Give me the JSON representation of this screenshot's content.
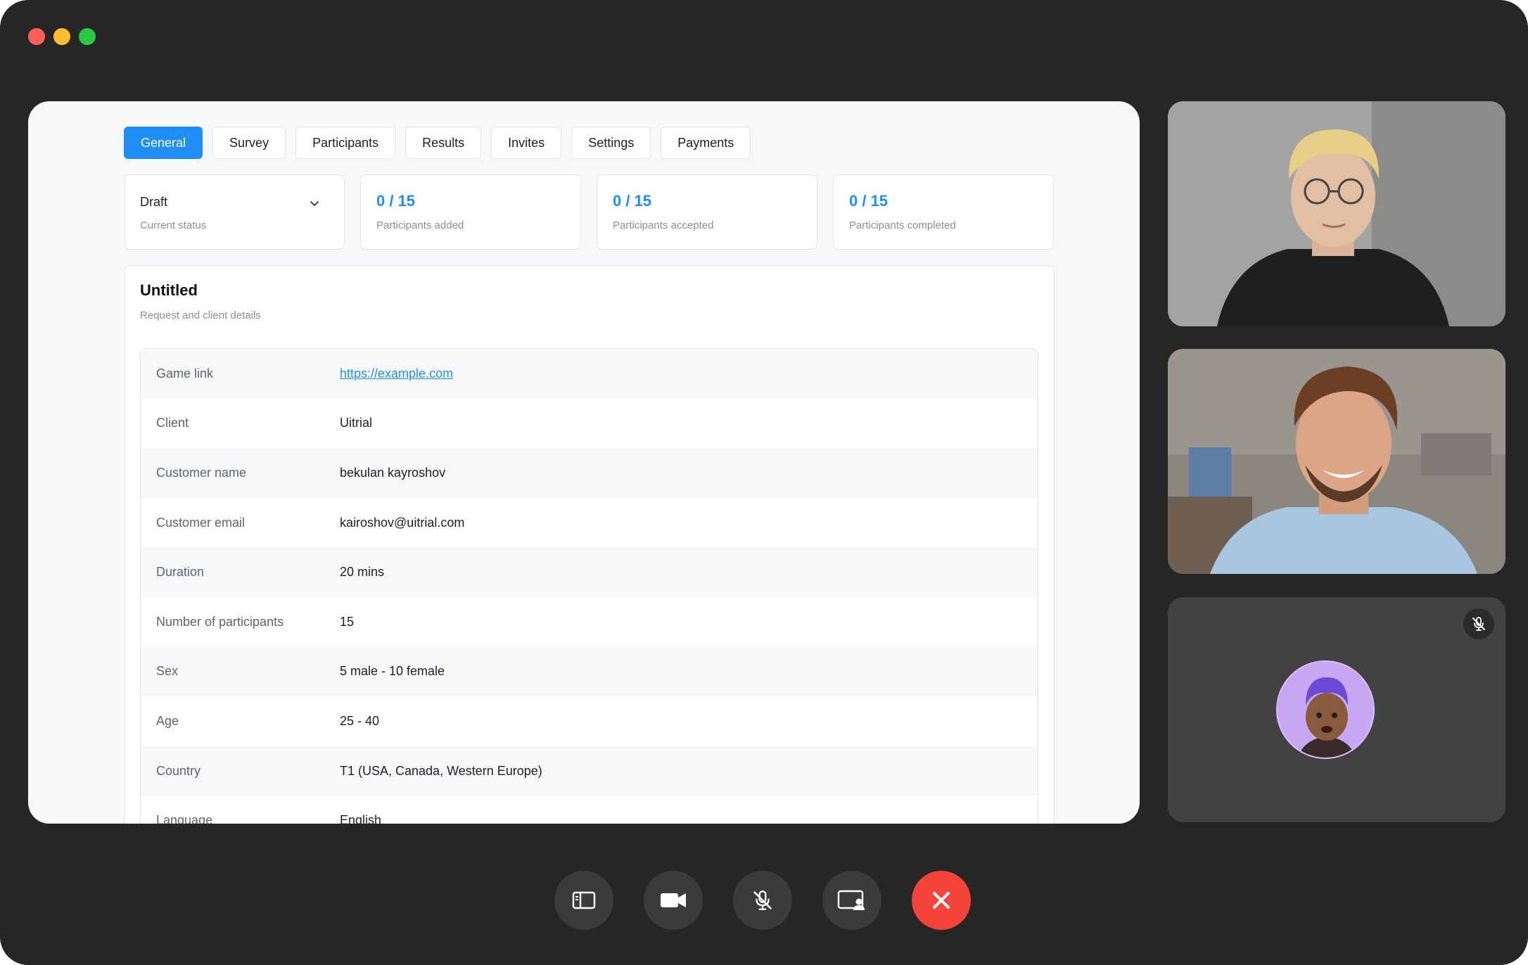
{
  "window": {
    "traffic_lights": {
      "close": "#ff5f57",
      "minimize": "#febc2e",
      "zoom": "#28c840"
    }
  },
  "tabs": [
    {
      "label": "General",
      "active": true
    },
    {
      "label": "Survey"
    },
    {
      "label": "Participants"
    },
    {
      "label": "Results"
    },
    {
      "label": "Invites"
    },
    {
      "label": "Settings"
    },
    {
      "label": "Payments"
    }
  ],
  "status": {
    "value": "Draft",
    "label": "Current status",
    "icon": "chevron-down-icon"
  },
  "stats": [
    {
      "value": "0 / 15",
      "label": "Participants added"
    },
    {
      "value": "0 / 15",
      "label": "Participants accepted"
    },
    {
      "value": "0 / 15",
      "label": "Participants completed"
    }
  ],
  "details": {
    "title": "Untitled",
    "subtitle": "Request and client details",
    "rows": [
      {
        "key": "Game link",
        "value": "https://example.com",
        "is_link": true
      },
      {
        "key": "Client",
        "value": "Uitrial"
      },
      {
        "key": "Customer name",
        "value": "bekulan kayroshov"
      },
      {
        "key": "Customer email",
        "value": "kairoshov@uitrial.com"
      },
      {
        "key": "Duration",
        "value": "20 mins"
      },
      {
        "key": "Number of participants",
        "value": "15"
      },
      {
        "key": "Sex",
        "value": "5 male - 10 female"
      },
      {
        "key": "Age",
        "value": "25 - 40"
      },
      {
        "key": "Country",
        "value": "T1 (USA, Canada, Western Europe)"
      },
      {
        "key": "Language",
        "value": "English"
      }
    ]
  },
  "video_tiles": [
    {
      "kind": "camera",
      "muted": false
    },
    {
      "kind": "camera",
      "muted": false
    },
    {
      "kind": "avatar",
      "muted": true,
      "icon": "mic-muted-icon"
    }
  ],
  "controls": [
    {
      "name": "toggle-sidebar",
      "icon": "sidebar-icon"
    },
    {
      "name": "toggle-camera",
      "icon": "video-camera-icon"
    },
    {
      "name": "toggle-mic",
      "icon": "mic-muted-icon"
    },
    {
      "name": "share-screen",
      "icon": "screen-share-icon"
    },
    {
      "name": "end-call",
      "icon": "close-icon",
      "color": "#f4433a"
    }
  ],
  "colors": {
    "accent": "#1e8ef4",
    "window_bg": "#262626",
    "end_call": "#f4433a"
  }
}
